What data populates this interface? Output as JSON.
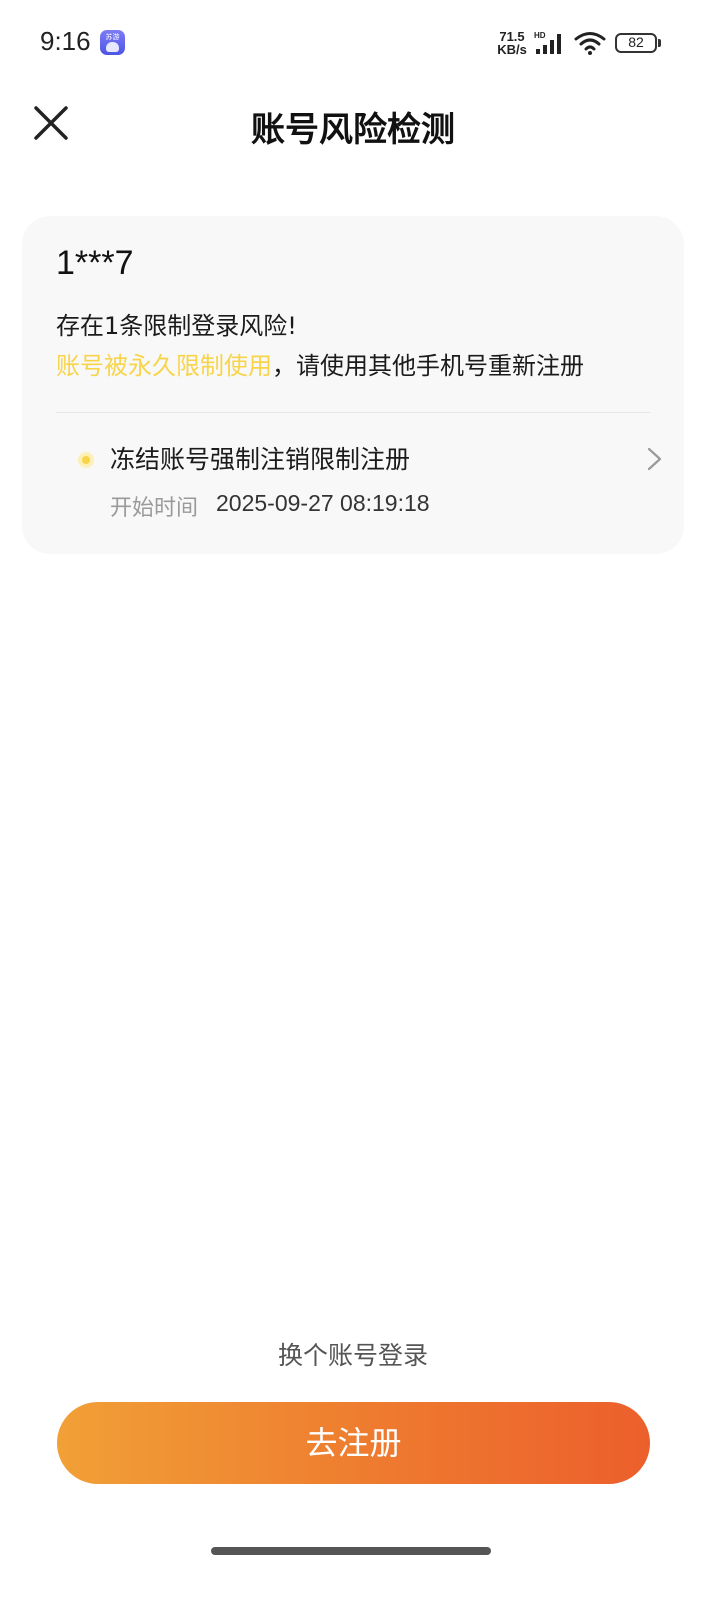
{
  "status_bar": {
    "time": "9:16",
    "app_badge_text": "苏游",
    "net_speed_value": "71.5",
    "net_speed_unit": "KB/s",
    "signal_label": "HD",
    "battery_level": "82"
  },
  "header": {
    "title": "账号风险检测",
    "close_icon": "close-icon"
  },
  "card": {
    "account_id": "1***7",
    "summary": "存在1条限制登录风险!",
    "highlight": "账号被永久限制使用",
    "instruction": "，请使用其他手机号重新注册",
    "item": {
      "title": "冻结账号强制注销限制注册",
      "time_label": "开始时间",
      "time_value": "2025-09-27 08:19:18"
    }
  },
  "footer": {
    "switch_account": "换个账号登录",
    "register_button": "去注册"
  },
  "colors": {
    "highlight": "#f7d44a",
    "button_start": "#f1a037",
    "button_end": "#ec5f2c"
  }
}
